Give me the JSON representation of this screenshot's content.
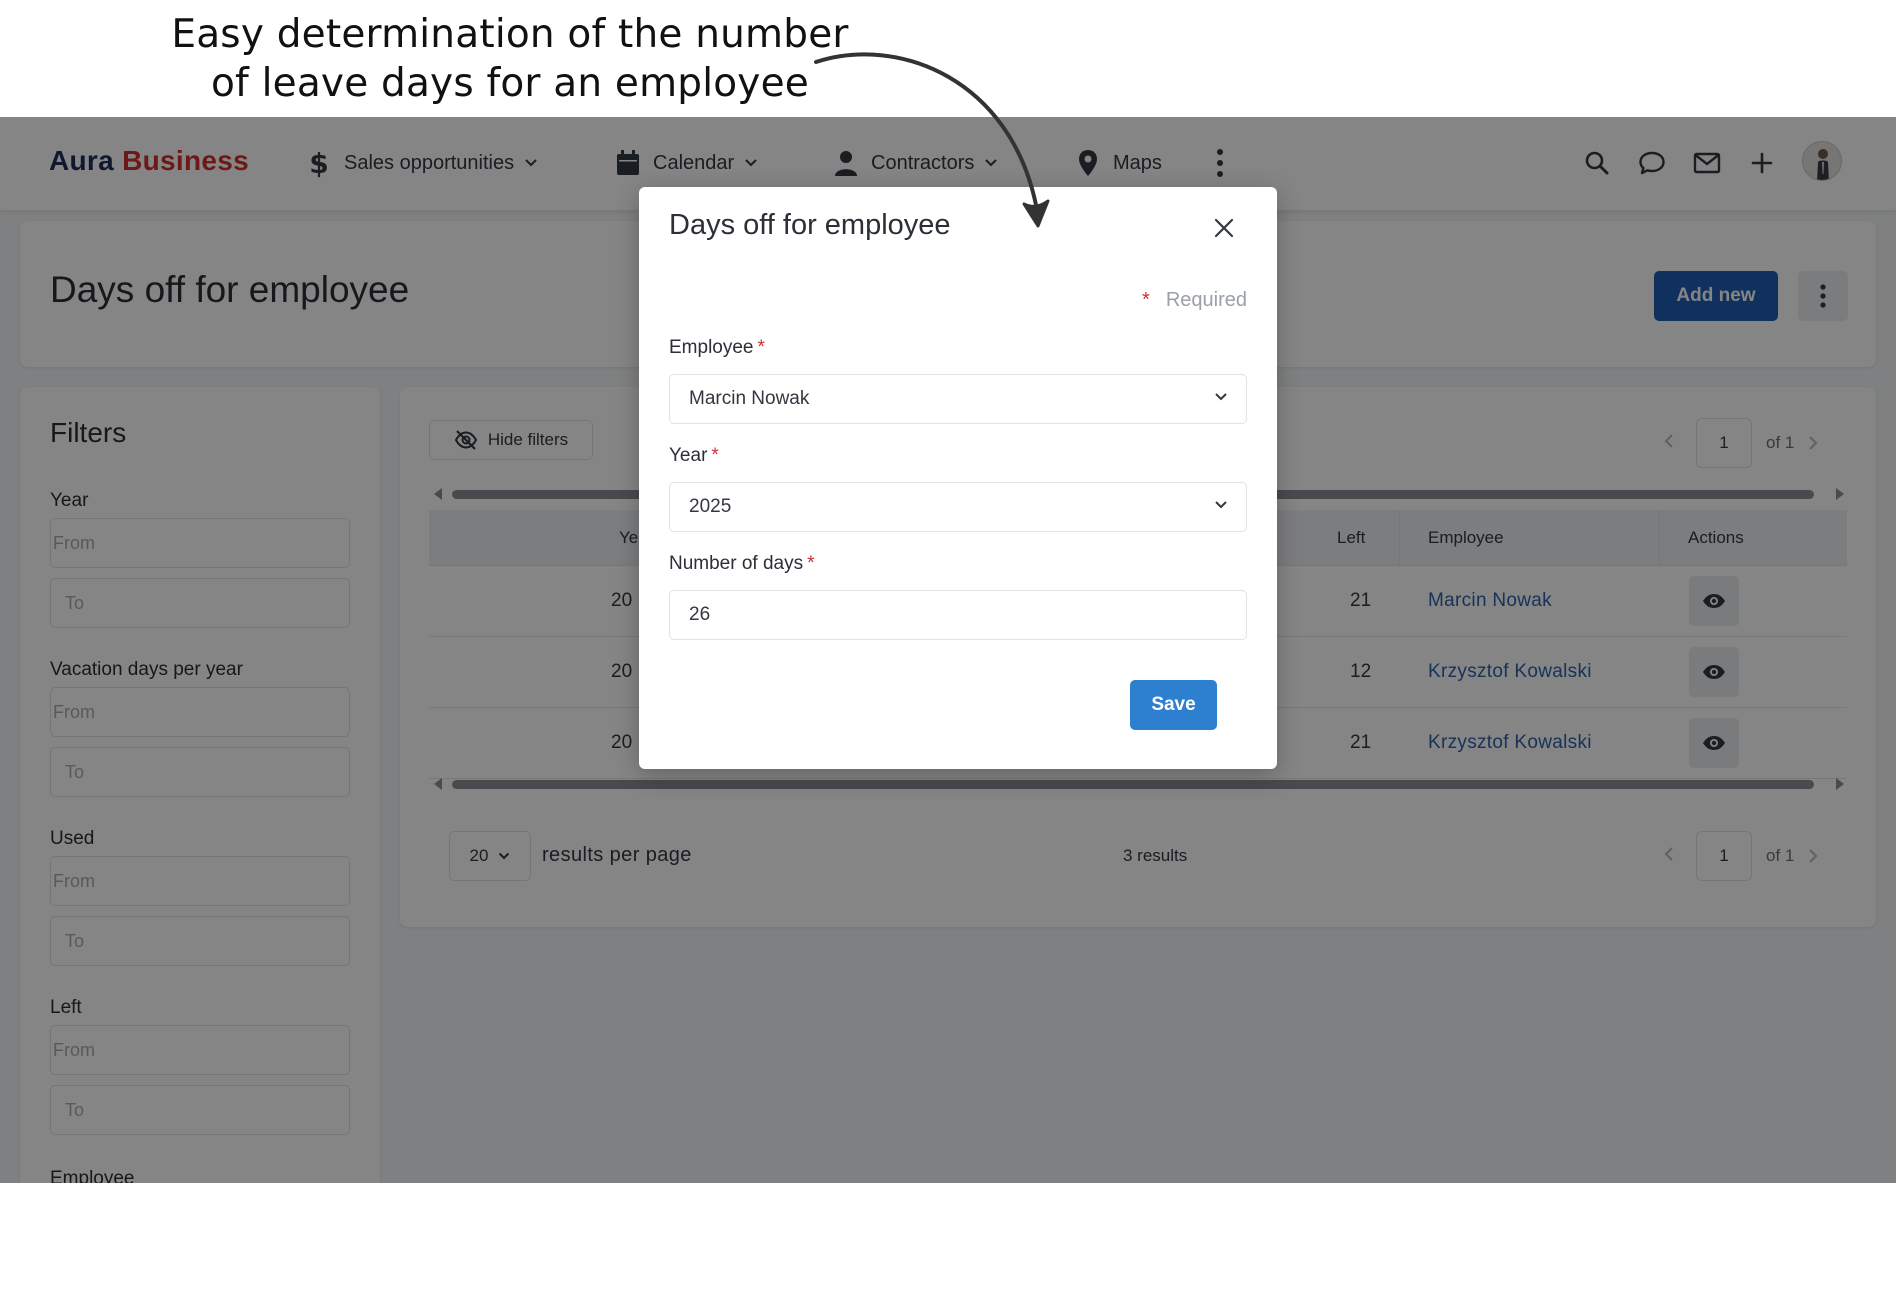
{
  "callout": {
    "line1": "Easy determination of the number",
    "line2": "of leave days for an employee"
  },
  "brand": {
    "part1": "Aura",
    "part2": "Business"
  },
  "nav": {
    "items": [
      {
        "label": "Sales opportunities",
        "icon": "dollar-icon",
        "has_dropdown": true
      },
      {
        "label": "Calendar",
        "icon": "calendar-icon",
        "has_dropdown": true
      },
      {
        "label": "Contractors",
        "icon": "person-icon",
        "has_dropdown": true
      },
      {
        "label": "Maps",
        "icon": "map-pin-icon",
        "has_dropdown": false
      }
    ],
    "right_icons": [
      "search-icon",
      "chat-icon",
      "mail-icon",
      "plus-icon",
      "avatar"
    ]
  },
  "page": {
    "title": "Days off for employee",
    "add_new_label": "Add new"
  },
  "filters": {
    "title": "Filters",
    "groups": [
      {
        "label": "Year",
        "from": "From",
        "to": "To"
      },
      {
        "label": "Vacation days per year",
        "from": "From",
        "to": "To"
      },
      {
        "label": "Used",
        "from": "From",
        "to": "To"
      },
      {
        "label": "Left",
        "from": "From",
        "to": "To"
      }
    ],
    "last_label": "Employee"
  },
  "table": {
    "hide_filters_label": "Hide filters",
    "pager": {
      "page": "1",
      "of": "of 1"
    },
    "columns": {
      "year": "Ye",
      "left": "Left",
      "employee": "Employee",
      "actions": "Actions"
    },
    "rows": [
      {
        "year": "20",
        "left": "21",
        "employee": "Marcin Nowak"
      },
      {
        "year": "20",
        "left": "12",
        "employee": "Krzysztof Kowalski"
      },
      {
        "year": "20",
        "left": "21",
        "employee": "Krzysztof Kowalski"
      }
    ],
    "per_page": "20",
    "per_page_label": "results per page",
    "results": "3 results"
  },
  "modal": {
    "title": "Days off for employee",
    "required_star": "*",
    "required_label": "Required",
    "employee_label": "Employee",
    "employee_value": "Marcin Nowak",
    "year_label": "Year",
    "year_value": "2025",
    "days_label": "Number of days",
    "days_value": "26",
    "save_label": "Save"
  },
  "colors": {
    "brand_dark": "#1f2c5b",
    "brand_red": "#d0302f",
    "primary_button": "#1f5fb3",
    "save_button": "#2d7fd0",
    "link": "#2d62ad"
  }
}
